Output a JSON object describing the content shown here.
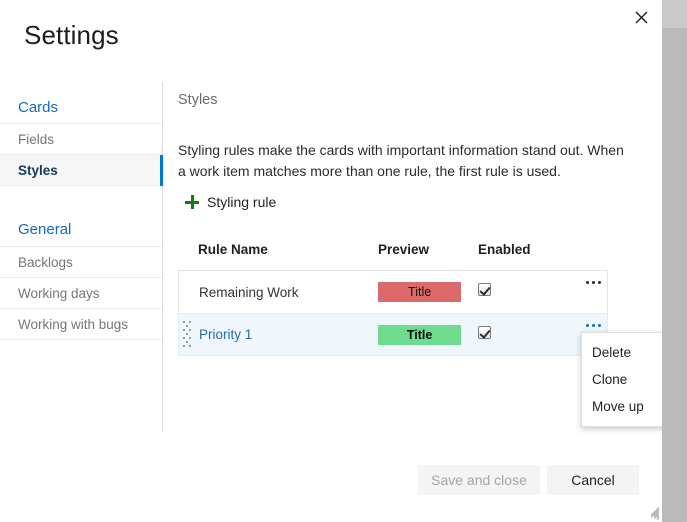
{
  "dialog": {
    "title": "Settings",
    "close_icon": "close-icon"
  },
  "nav": {
    "groups": [
      {
        "title": "Cards",
        "items": [
          {
            "label": "Fields",
            "selected": false
          },
          {
            "label": "Styles",
            "selected": true
          }
        ]
      },
      {
        "title": "General",
        "items": [
          {
            "label": "Backlogs",
            "selected": false
          },
          {
            "label": "Working days",
            "selected": false
          },
          {
            "label": "Working with bugs",
            "selected": false
          }
        ]
      }
    ]
  },
  "content": {
    "section_label": "Styles",
    "description": "Styling rules make the cards with important information stand out. When a work item matches more than one rule, the first rule is used.",
    "add_rule_label": "Styling rule",
    "add_rule_icon": "plus-icon"
  },
  "table": {
    "headers": {
      "name": "Rule Name",
      "preview": "Preview",
      "enabled": "Enabled"
    },
    "rows": [
      {
        "name": "Remaining Work",
        "preview_text": "Title",
        "preview_color": "#dd6a6a",
        "preview_bold": false,
        "enabled": true,
        "selected": false,
        "menu_icon": "more-options-icon"
      },
      {
        "name": "Priority 1",
        "preview_text": "Title",
        "preview_color": "#6edb91",
        "preview_bold": true,
        "enabled": true,
        "selected": true,
        "menu_icon": "more-options-icon"
      }
    ]
  },
  "context_menu": {
    "items": [
      {
        "label": "Delete"
      },
      {
        "label": "Clone"
      },
      {
        "label": "Move up"
      }
    ]
  },
  "footer": {
    "save_label": "Save and close",
    "cancel_label": "Cancel"
  },
  "colors": {
    "accent": "#0078d4",
    "link": "#0f6cbd",
    "selected_row": "#eff6fc",
    "add_icon_green": "#107c10"
  }
}
